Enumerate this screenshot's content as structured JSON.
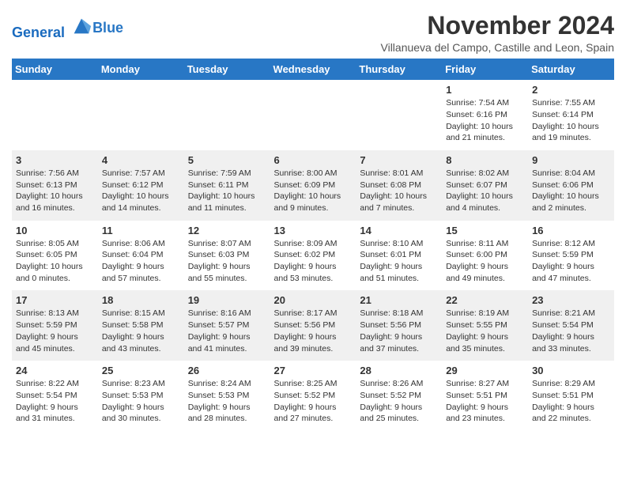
{
  "logo": {
    "line1": "General",
    "line2": "Blue"
  },
  "title": "November 2024",
  "subtitle": "Villanueva del Campo, Castille and Leon, Spain",
  "weekdays": [
    "Sunday",
    "Monday",
    "Tuesday",
    "Wednesday",
    "Thursday",
    "Friday",
    "Saturday"
  ],
  "weeks": [
    [
      {
        "day": "",
        "info": ""
      },
      {
        "day": "",
        "info": ""
      },
      {
        "day": "",
        "info": ""
      },
      {
        "day": "",
        "info": ""
      },
      {
        "day": "",
        "info": ""
      },
      {
        "day": "1",
        "info": "Sunrise: 7:54 AM\nSunset: 6:16 PM\nDaylight: 10 hours and 21 minutes."
      },
      {
        "day": "2",
        "info": "Sunrise: 7:55 AM\nSunset: 6:14 PM\nDaylight: 10 hours and 19 minutes."
      }
    ],
    [
      {
        "day": "3",
        "info": "Sunrise: 7:56 AM\nSunset: 6:13 PM\nDaylight: 10 hours and 16 minutes."
      },
      {
        "day": "4",
        "info": "Sunrise: 7:57 AM\nSunset: 6:12 PM\nDaylight: 10 hours and 14 minutes."
      },
      {
        "day": "5",
        "info": "Sunrise: 7:59 AM\nSunset: 6:11 PM\nDaylight: 10 hours and 11 minutes."
      },
      {
        "day": "6",
        "info": "Sunrise: 8:00 AM\nSunset: 6:09 PM\nDaylight: 10 hours and 9 minutes."
      },
      {
        "day": "7",
        "info": "Sunrise: 8:01 AM\nSunset: 6:08 PM\nDaylight: 10 hours and 7 minutes."
      },
      {
        "day": "8",
        "info": "Sunrise: 8:02 AM\nSunset: 6:07 PM\nDaylight: 10 hours and 4 minutes."
      },
      {
        "day": "9",
        "info": "Sunrise: 8:04 AM\nSunset: 6:06 PM\nDaylight: 10 hours and 2 minutes."
      }
    ],
    [
      {
        "day": "10",
        "info": "Sunrise: 8:05 AM\nSunset: 6:05 PM\nDaylight: 10 hours and 0 minutes."
      },
      {
        "day": "11",
        "info": "Sunrise: 8:06 AM\nSunset: 6:04 PM\nDaylight: 9 hours and 57 minutes."
      },
      {
        "day": "12",
        "info": "Sunrise: 8:07 AM\nSunset: 6:03 PM\nDaylight: 9 hours and 55 minutes."
      },
      {
        "day": "13",
        "info": "Sunrise: 8:09 AM\nSunset: 6:02 PM\nDaylight: 9 hours and 53 minutes."
      },
      {
        "day": "14",
        "info": "Sunrise: 8:10 AM\nSunset: 6:01 PM\nDaylight: 9 hours and 51 minutes."
      },
      {
        "day": "15",
        "info": "Sunrise: 8:11 AM\nSunset: 6:00 PM\nDaylight: 9 hours and 49 minutes."
      },
      {
        "day": "16",
        "info": "Sunrise: 8:12 AM\nSunset: 5:59 PM\nDaylight: 9 hours and 47 minutes."
      }
    ],
    [
      {
        "day": "17",
        "info": "Sunrise: 8:13 AM\nSunset: 5:59 PM\nDaylight: 9 hours and 45 minutes."
      },
      {
        "day": "18",
        "info": "Sunrise: 8:15 AM\nSunset: 5:58 PM\nDaylight: 9 hours and 43 minutes."
      },
      {
        "day": "19",
        "info": "Sunrise: 8:16 AM\nSunset: 5:57 PM\nDaylight: 9 hours and 41 minutes."
      },
      {
        "day": "20",
        "info": "Sunrise: 8:17 AM\nSunset: 5:56 PM\nDaylight: 9 hours and 39 minutes."
      },
      {
        "day": "21",
        "info": "Sunrise: 8:18 AM\nSunset: 5:56 PM\nDaylight: 9 hours and 37 minutes."
      },
      {
        "day": "22",
        "info": "Sunrise: 8:19 AM\nSunset: 5:55 PM\nDaylight: 9 hours and 35 minutes."
      },
      {
        "day": "23",
        "info": "Sunrise: 8:21 AM\nSunset: 5:54 PM\nDaylight: 9 hours and 33 minutes."
      }
    ],
    [
      {
        "day": "24",
        "info": "Sunrise: 8:22 AM\nSunset: 5:54 PM\nDaylight: 9 hours and 31 minutes."
      },
      {
        "day": "25",
        "info": "Sunrise: 8:23 AM\nSunset: 5:53 PM\nDaylight: 9 hours and 30 minutes."
      },
      {
        "day": "26",
        "info": "Sunrise: 8:24 AM\nSunset: 5:53 PM\nDaylight: 9 hours and 28 minutes."
      },
      {
        "day": "27",
        "info": "Sunrise: 8:25 AM\nSunset: 5:52 PM\nDaylight: 9 hours and 27 minutes."
      },
      {
        "day": "28",
        "info": "Sunrise: 8:26 AM\nSunset: 5:52 PM\nDaylight: 9 hours and 25 minutes."
      },
      {
        "day": "29",
        "info": "Sunrise: 8:27 AM\nSunset: 5:51 PM\nDaylight: 9 hours and 23 minutes."
      },
      {
        "day": "30",
        "info": "Sunrise: 8:29 AM\nSunset: 5:51 PM\nDaylight: 9 hours and 22 minutes."
      }
    ]
  ]
}
